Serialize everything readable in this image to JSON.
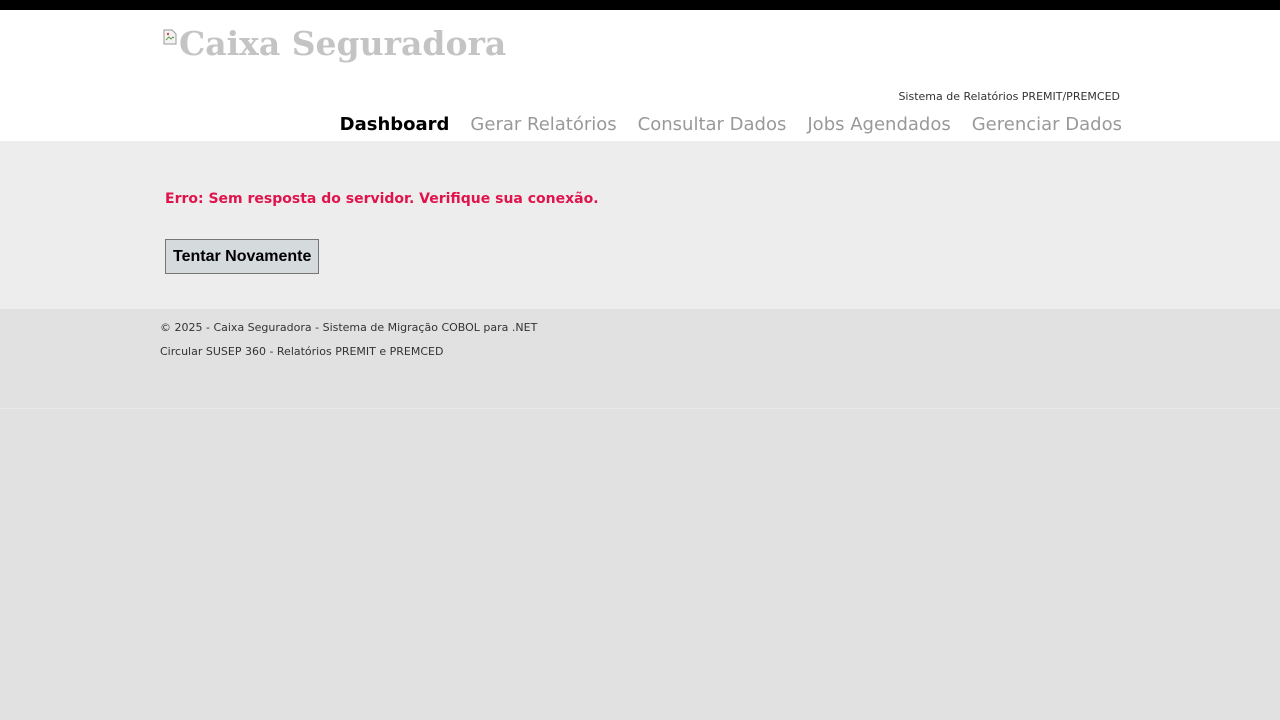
{
  "header": {
    "logo_alt": "Caixa Seguradora",
    "system_name": "Sistema de Relatórios PREMIT/PREMCED"
  },
  "nav": {
    "items": [
      {
        "label": "Dashboard",
        "active": true
      },
      {
        "label": "Gerar Relatórios",
        "active": false
      },
      {
        "label": "Consultar Dados",
        "active": false
      },
      {
        "label": "Jobs Agendados",
        "active": false
      },
      {
        "label": "Gerenciar Dados",
        "active": false
      }
    ]
  },
  "main": {
    "error_message": "Erro: Sem resposta do servidor. Verifique sua conexão.",
    "retry_label": "Tentar Novamente"
  },
  "footer": {
    "copyright": "© 2025 - Caixa Seguradora - Sistema de Migração COBOL para .NET",
    "circular": "Circular SUSEP 360 - Relatórios PREMIT e PREMCED"
  },
  "colors": {
    "error": "#e0144c",
    "nav_inactive": "#999999",
    "nav_active": "#000000"
  }
}
